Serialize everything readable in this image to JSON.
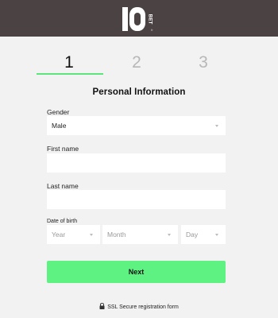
{
  "header": {
    "logo_text": "10 BET",
    "logo_icon": "10bet-logo-icon",
    "background_color": "#4a4243"
  },
  "steps": {
    "items": [
      "1",
      "2",
      "3"
    ],
    "active_index": 0,
    "active_color": "#5de47d"
  },
  "form": {
    "title": "Personal Information",
    "gender_label": "Gender",
    "gender_value": "Male",
    "first_name_label": "First name",
    "first_name_value": "",
    "last_name_label": "Last name",
    "last_name_value": "",
    "dob_label": "Date of birth",
    "dob_year": "Year",
    "dob_month": "Month",
    "dob_day": "Day",
    "next_label": "Next"
  },
  "footer": {
    "secure_text": "SSL Secure registration form",
    "lock_icon": "lock-icon"
  },
  "colors": {
    "accent": "#5ef283",
    "page_background": "#f2f2f2"
  }
}
